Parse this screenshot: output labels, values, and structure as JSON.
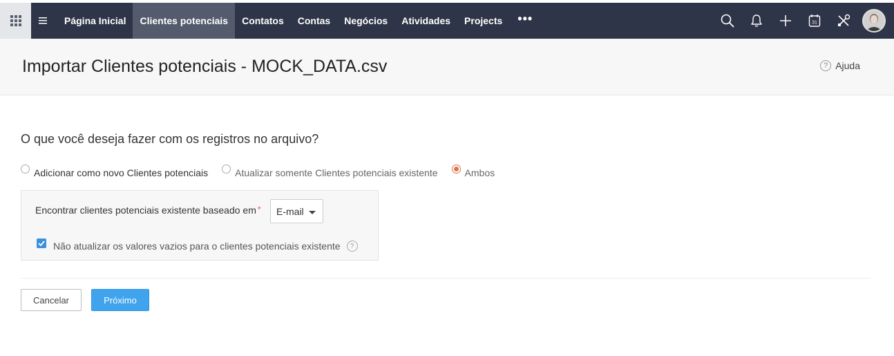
{
  "nav": {
    "tabs": [
      {
        "label": "Página Inicial",
        "active": false
      },
      {
        "label": "Clientes potenciais",
        "active": true
      },
      {
        "label": "Contatos",
        "active": false
      },
      {
        "label": "Contas",
        "active": false
      },
      {
        "label": "Negócios",
        "active": false
      },
      {
        "label": "Atividades",
        "active": false
      },
      {
        "label": "Projects",
        "active": false
      }
    ],
    "more_label": "•••",
    "calendar_day": "31",
    "icons": [
      "apps-grid-icon",
      "hamburger-icon",
      "search-icon",
      "bell-icon",
      "plus-icon",
      "calendar-icon",
      "tools-icon",
      "avatar"
    ]
  },
  "header": {
    "title": "Importar Clientes potenciais - MOCK_DATA.csv",
    "help_label": "Ajuda",
    "help_glyph": "?"
  },
  "form": {
    "question": "O que você deseja fazer com os registros no arquivo?",
    "options": [
      {
        "label": "Adicionar como novo Clientes potenciais",
        "checked": false
      },
      {
        "label": "Atualizar somente Clientes potenciais existente",
        "checked": false
      },
      {
        "label": "Ambos",
        "checked": true
      }
    ],
    "find_label": "Encontrar clientes potenciais existente baseado em",
    "required_mark": "*",
    "find_value": "E-mail",
    "checkbox_label": "Não atualizar os valores vazios para o clientes potenciais existente",
    "checkbox_checked": true,
    "info_glyph": "?"
  },
  "actions": {
    "cancel_label": "Cancelar",
    "next_label": "Próximo"
  },
  "colors": {
    "navbar": "#2f3548",
    "active_tab": "#545b6d",
    "primary_button": "#3fa3ee",
    "radio_accent": "#e0734a",
    "checkbox": "#3d8fe0"
  }
}
